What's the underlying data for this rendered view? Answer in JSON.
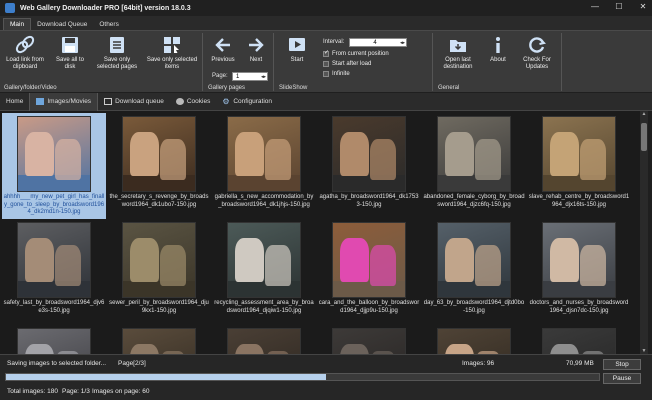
{
  "window": {
    "title": "Web Gallery Downloader PRO [64bit] version 18.0.3",
    "controls": [
      "—",
      "☐",
      "✕"
    ]
  },
  "ribbon_tabs": [
    {
      "label": "Main",
      "active": true
    },
    {
      "label": "Download Queue",
      "active": false
    },
    {
      "label": "Others",
      "active": false
    }
  ],
  "ribbon": {
    "groups": {
      "gallery_folder_video": "Gallery/folder/Video",
      "gallery_pages": "Gallery pages",
      "slideshow": "SlideShow",
      "general": "General"
    },
    "buttons": {
      "load_link": "Load link from clipboard",
      "save_all": "Save all to disk",
      "save_selected_pages": "Save only selected pages",
      "save_selected_items": "Save only selected items",
      "previous": "Previous",
      "next": "Next",
      "start": "Start",
      "open_last": "Open last destination",
      "about": "About",
      "check_updates": "Check For Updates"
    },
    "page_label": "Page:",
    "page_value": "1",
    "interval_label": "Interval:",
    "interval_value": "4",
    "options": {
      "from_current": "From current position",
      "start_after_load": "Start after load",
      "infinite": "Infinite"
    }
  },
  "nav_tabs": [
    {
      "label": "Home",
      "active": false
    },
    {
      "label": "Images/Movies",
      "active": true
    },
    {
      "label": "Download queue",
      "active": false
    },
    {
      "label": "Cookies",
      "active": false
    },
    {
      "label": "Configuration",
      "active": false
    }
  ],
  "gallery": {
    "items": [
      {
        "caption": "ahhhh___my_new_pet_girl_has_finally_gone_to_sleep_by_broadsword1964_dk2md1n-150.jpg",
        "selected": true,
        "colors": [
          "#c99a86",
          "#d8b3a3",
          "#4f73a3"
        ]
      },
      {
        "caption": "the_secretary_s_revenge_by_broadsword1964_dk1ubo7-150.jpg",
        "selected": false,
        "colors": [
          "#7a5a3a",
          "#c9a27f",
          "#3b2b1f"
        ]
      },
      {
        "caption": "gabriella_s_new_accommodation_by_broadsword1964_dk1jhjs-150.jpg",
        "selected": false,
        "colors": [
          "#8a6b48",
          "#c8a07a",
          "#5a4330"
        ]
      },
      {
        "caption": "agatha_by_broadsword1964_dk17533-150.jpg",
        "selected": false,
        "colors": [
          "#4a3a2c",
          "#b08a6a",
          "#2a2a2a"
        ]
      },
      {
        "caption": "abandoned_female_cyborg_by_broadsword1964_djzc6fq-150.jpg",
        "selected": false,
        "colors": [
          "#6f6a60",
          "#a59c8d",
          "#3a3a3a"
        ]
      },
      {
        "caption": "slave_rehab_centre_by_broadsword1964_djx16ts-150.jpg",
        "selected": false,
        "colors": [
          "#8b7350",
          "#c4a376",
          "#54452f"
        ]
      },
      {
        "caption": "safety_last_by_broadsword1964_djv6e3s-150.jpg",
        "selected": false,
        "colors": [
          "#5d5e61",
          "#a48c77",
          "#2e3238"
        ]
      },
      {
        "caption": "sewer_peril_by_broadsword1964_dju9kx1-150.jpg",
        "selected": false,
        "colors": [
          "#5a5443",
          "#9c8c6a",
          "#3b3528"
        ]
      },
      {
        "caption": "recycling_assessment_area_by_broadsword1964_djqiw1-150.jpg",
        "selected": false,
        "colors": [
          "#4c5a58",
          "#cfc9c1",
          "#2c3333"
        ]
      },
      {
        "caption": "cara_and_the_balloon_by_broadsword1964_djjp9u-150.jpg",
        "selected": false,
        "colors": [
          "#8d5d3a",
          "#e04ab0",
          "#6c5a48"
        ]
      },
      {
        "caption": "day_63_by_broadsword1964_djtd0bo-150.jpg",
        "selected": false,
        "colors": [
          "#556069",
          "#c1a58b",
          "#2f363c"
        ]
      },
      {
        "caption": "doctors_and_nurses_by_broadsword1964_djsn7dc-150.jpg",
        "selected": false,
        "colors": [
          "#6a6f76",
          "#d0b9a4",
          "#3a3d42"
        ]
      },
      {
        "caption": "",
        "selected": false,
        "colors": [
          "#6b6b70",
          "#a3a3a8",
          "#3a3a3f"
        ]
      },
      {
        "caption": "",
        "selected": false,
        "colors": [
          "#5a4c3c",
          "#8c7864",
          "#2f281f"
        ]
      },
      {
        "caption": "",
        "selected": false,
        "colors": [
          "#4a3f35",
          "#8a7462",
          "#2a241e"
        ]
      },
      {
        "caption": "",
        "selected": false,
        "colors": [
          "#3d3a38",
          "#6b625b",
          "#252221"
        ]
      },
      {
        "caption": "",
        "selected": false,
        "colors": [
          "#4f4336",
          "#c7a487",
          "#2c251d"
        ]
      },
      {
        "caption": "",
        "selected": false,
        "colors": [
          "#3a3a3a",
          "#8e8e8e",
          "#222"
        ]
      }
    ]
  },
  "status": {
    "saving_text": "Saving images to selected folder...",
    "page_text": "Page[2/3]",
    "images_text": "Images: 96",
    "size_text": "70,99 MB",
    "progress_fraction": 0.54,
    "total_images": "Total images: 180",
    "page_of": "Page: 1/3",
    "images_on_page": "Images on page: 60",
    "stop_label": "Stop",
    "pause_label": "Pause"
  },
  "colors": {
    "accent": "#3d7ecb",
    "selection": "#a9c6e6",
    "progress": "#b6d0ec"
  }
}
